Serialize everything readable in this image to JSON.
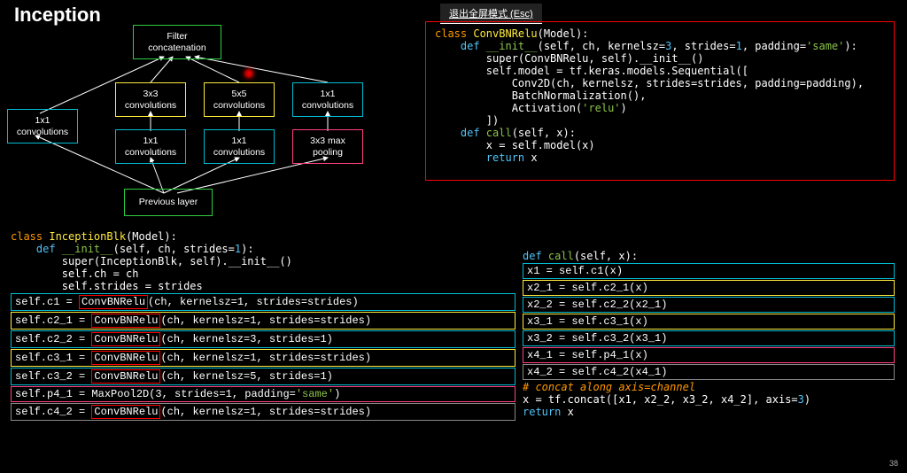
{
  "title": "Inception",
  "esc_label": "退出全屏模式 (Esc)",
  "diagram": {
    "top": "Filter\nconcatenation",
    "left": "1x1\nconvolutions",
    "r1c1": "3x3\nconvolutions",
    "r1c2": "5x5\nconvolutions",
    "r1c3": "1x1\nconvolutions",
    "r2c1": "1x1\nconvolutions",
    "r2c2": "1x1\nconvolutions",
    "r2c3": "3x3 max\npooling",
    "bottom": "Previous layer"
  },
  "code_top": {
    "l1": {
      "a": "class ",
      "b": "ConvBNRelu",
      "c": "(Model):"
    },
    "l2": {
      "a": "    def ",
      "b": "__init__",
      "c": "(self, ch, kernelsz=",
      "d": "3",
      "e": ", strides=",
      "f": "1",
      "g": ", padding=",
      "h": "'same'",
      "i": "):"
    },
    "l3": "        super(ConvBNRelu, self).__init__()",
    "l4": "        self.model = tf.keras.models.Sequential([",
    "l5": "            Conv2D(ch, kernelsz, strides=strides, padding=padding),",
    "l6": "            BatchNormalization(),",
    "l7": {
      "a": "            Activation(",
      "b": "'relu'",
      "c": ")"
    },
    "l8": "        ])",
    "l9": "",
    "l10": {
      "a": "    def ",
      "b": "call",
      "c": "(self, x):"
    },
    "l11": "        x = self.model(x)",
    "l12": {
      "a": "        return ",
      "b": "x"
    }
  },
  "code_bl": {
    "h1": {
      "a": "class ",
      "b": "InceptionBlk",
      "c": "(Model):"
    },
    "h2": {
      "a": "    def ",
      "b": "__init__",
      "c": "(self, ch, strides=",
      "d": "1",
      "e": "):"
    },
    "h3": "        super(InceptionBlk, self).__init__()",
    "h4": "        self.ch = ch",
    "h5": "        self.strides = strides",
    "r1": {
      "pre": "    self.c1 = ",
      "box": "ConvBNRelu",
      "post": "(ch, kernelsz=1, strides=strides)"
    },
    "r2": {
      "pre": "    self.c2_1 = ",
      "box": "ConvBNRelu",
      "post": "(ch, kernelsz=1, strides=strides)"
    },
    "r3": {
      "pre": "    self.c2_2 = ",
      "box": "ConvBNRelu",
      "post": "(ch, kernelsz=3, strides=1)"
    },
    "r4": {
      "pre": "    self.c3_1 = ",
      "box": "ConvBNRelu",
      "post": "(ch, kernelsz=1, strides=strides)"
    },
    "r5": {
      "pre": "    self.c3_2 = ",
      "box": "ConvBNRelu",
      "post": "(ch, kernelsz=5, strides=1)"
    },
    "r6": {
      "pre": "    self.p4_1 = MaxPool2D(3, strides=1, padding=",
      "str": "'same'",
      "post": ")"
    },
    "r7": {
      "pre": "    self.c4_2 = ",
      "box": "ConvBNRelu",
      "post": "(ch, kernelsz=1, strides=strides)"
    }
  },
  "code_br": {
    "h1": {
      "a": "def ",
      "b": "call",
      "c": "(self, x):"
    },
    "r1": "x1 = self.c1(x)",
    "r2": "x2_1 = self.c2_1(x)",
    "r3": "x2_2 = self.c2_2(x2_1)",
    "r4": "x3_1 = self.c3_1(x)",
    "r5": "x3_2 = self.c3_2(x3_1)",
    "r6": "x4_1 = self.p4_1(x)",
    "r7": "x4_2 = self.c4_2(x4_1)",
    "c1": "# concat along axis=channel",
    "l1": {
      "a": "x = tf.concat([x1, x2_2, x3_2, x4_2], axis=",
      "b": "3",
      "c": ")"
    },
    "l2": {
      "a": "return ",
      "b": "x"
    }
  },
  "page": "38"
}
